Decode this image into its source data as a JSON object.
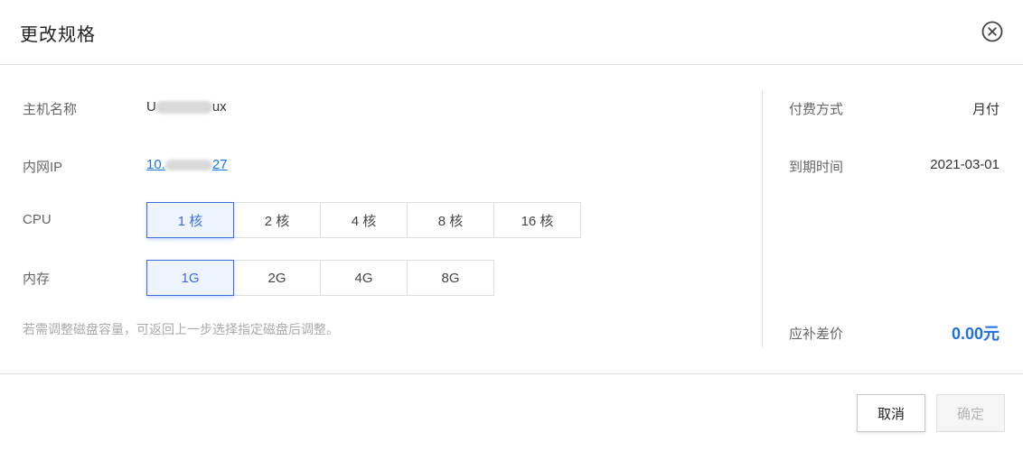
{
  "dialog": {
    "title": "更改规格",
    "close_icon": "close-circle-icon"
  },
  "host": {
    "name_label": "主机名称",
    "name_prefix": "U",
    "name_suffix": "ux",
    "ip_label": "内网IP",
    "ip_prefix": "10.",
    "ip_suffix": "27"
  },
  "cpu": {
    "label": "CPU",
    "options": [
      "1 核",
      "2 核",
      "4 核",
      "8 核",
      "16 核"
    ],
    "selected": "1 核"
  },
  "memory": {
    "label": "内存",
    "options": [
      "1G",
      "2G",
      "4G",
      "8G"
    ],
    "selected": "1G"
  },
  "hint": "若需调整磁盘容量，可返回上一步选择指定磁盘后调整。",
  "side": {
    "pay_label": "付费方式",
    "pay_value": "月付",
    "expire_label": "到期时间",
    "expire_value": "2021-03-01",
    "diff_label": "应补差价",
    "diff_value": "0.00元"
  },
  "footer": {
    "cancel_label": "取消",
    "confirm_label": "确定"
  },
  "colors": {
    "accent": "#3b6fe0",
    "price": "#1f6fe5",
    "link": "#1a73e8"
  }
}
